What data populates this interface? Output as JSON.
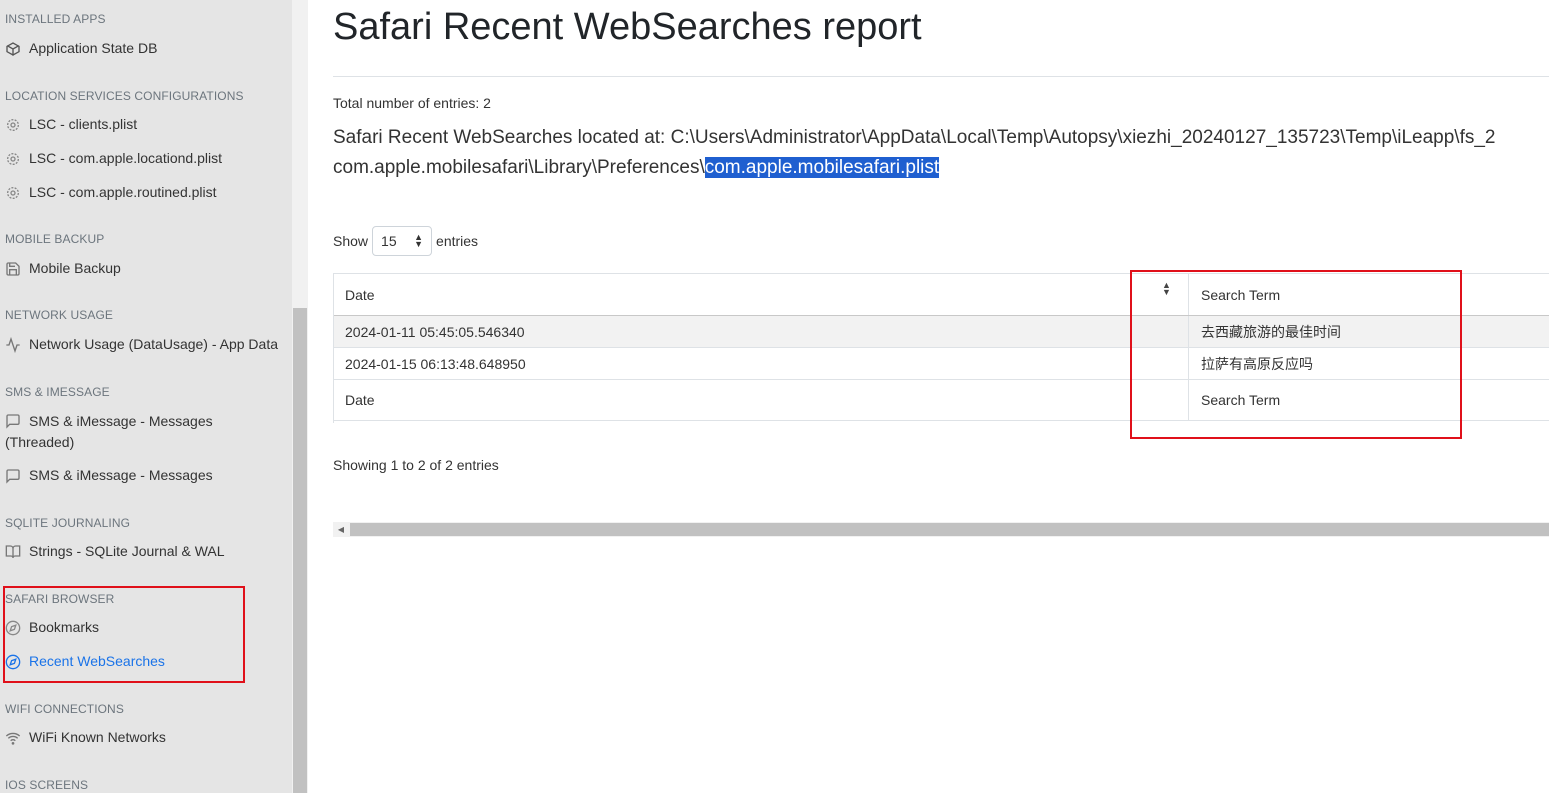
{
  "sidebar": {
    "sections": [
      {
        "heading": "INSTALLED APPS",
        "items": [
          {
            "label": "Application State DB",
            "icon": "package-icon"
          }
        ]
      },
      {
        "heading": "LOCATION SERVICES CONFIGURATIONS",
        "items": [
          {
            "label": "LSC - clients.plist",
            "icon": "gear-icon"
          },
          {
            "label": "LSC - com.apple.locationd.plist",
            "icon": "gear-icon"
          },
          {
            "label": "LSC - com.apple.routined.plist",
            "icon": "gear-icon"
          }
        ]
      },
      {
        "heading": "MOBILE BACKUP",
        "items": [
          {
            "label": "Mobile Backup",
            "icon": "save-icon"
          }
        ]
      },
      {
        "heading": "NETWORK USAGE",
        "items": [
          {
            "label": "Network Usage (DataUsage) - App Data",
            "icon": "activity-icon"
          }
        ]
      },
      {
        "heading": "SMS & IMESSAGE",
        "items": [
          {
            "label": "SMS & iMessage - Messages (Threaded)",
            "icon": "message-square-icon"
          },
          {
            "label": "SMS & iMessage - Messages",
            "icon": "message-square-icon"
          }
        ]
      },
      {
        "heading": "SQLITE JOURNALING",
        "items": [
          {
            "label": "Strings - SQLite Journal & WAL",
            "icon": "book-open-icon"
          }
        ]
      },
      {
        "heading": "SAFARI BROWSER",
        "items": [
          {
            "label": "Bookmarks",
            "icon": "compass-icon"
          },
          {
            "label": "Recent WebSearches",
            "icon": "compass-icon",
            "active": true
          }
        ]
      },
      {
        "heading": "WIFI CONNECTIONS",
        "items": [
          {
            "label": "WiFi Known Networks",
            "icon": "wifi-icon"
          }
        ]
      },
      {
        "heading": "IOS SCREENS",
        "items": []
      }
    ]
  },
  "main": {
    "title": "Safari Recent WebSearches report",
    "total_entries": "Total number of entries: 2",
    "located_line1": "Safari Recent WebSearches located at: C:\\Users\\Administrator\\AppData\\Local\\Temp\\Autopsy\\xiezhi_20240127_135723\\Temp\\iLeapp\\fs_2",
    "located_line2_prefix": "com.apple.mobilesafari\\Library\\Preferences\\",
    "located_line2_selected": "com.apple.mobilesafari.plist",
    "show_label": "Show",
    "page_length": "15",
    "entries_label": "entries",
    "table": {
      "columns": [
        "Date",
        "Search Term"
      ],
      "rows": [
        [
          "2024-01-11 05:45:05.546340",
          "去西藏旅游的最佳时间"
        ],
        [
          "2024-01-15 06:13:48.648950",
          "拉萨有高原反应吗"
        ]
      ],
      "footer": [
        "Date",
        "Search Term"
      ]
    },
    "showing_info": "Showing 1 to 2 of 2 entries"
  },
  "colors": {
    "active_link": "#1a73e8",
    "highlight": "#1f5fd0",
    "annotation_red": "#e0101a"
  }
}
